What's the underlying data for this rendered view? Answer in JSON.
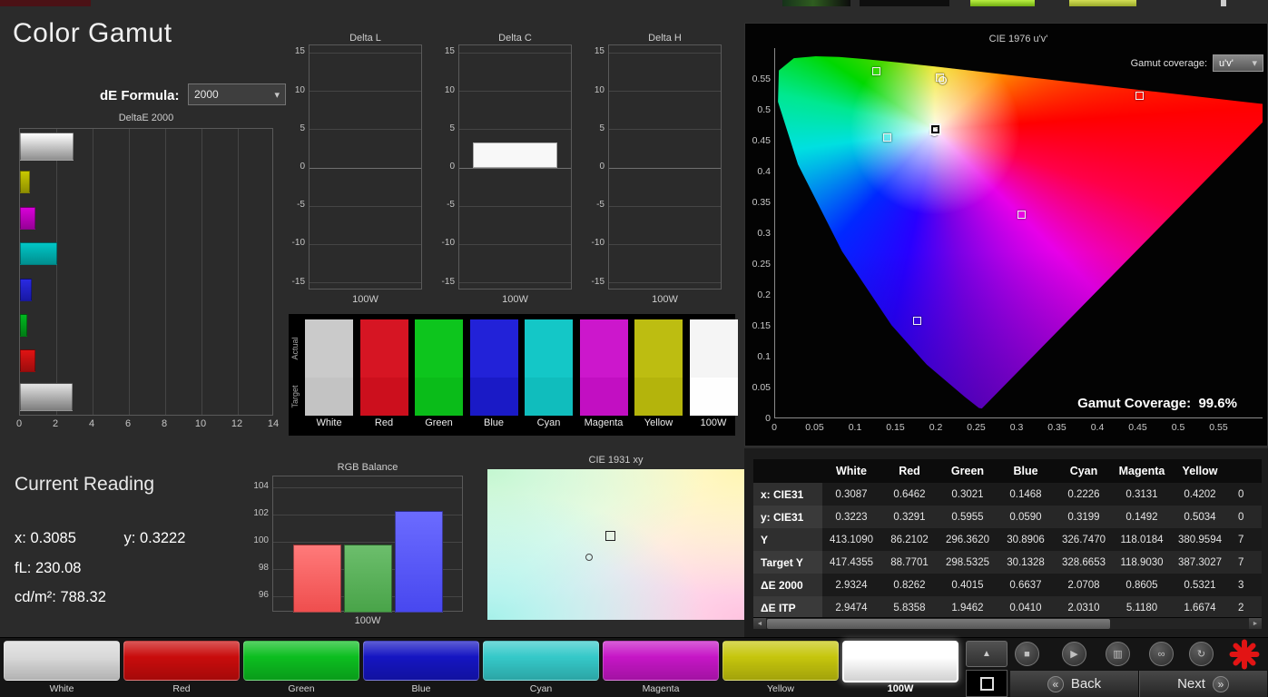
{
  "header": {
    "title": "Color Gamut",
    "de_formula_label": "dE Formula:",
    "de_formula_value": "2000"
  },
  "swatches": {
    "actual_label": "Actual",
    "target_label": "Target",
    "items": [
      {
        "label": "White",
        "actual": "#cacaca",
        "target": "#c3c3c3"
      },
      {
        "label": "Red",
        "actual": "#d61523",
        "target": "#cc0f1d"
      },
      {
        "label": "Green",
        "actual": "#0dc51d",
        "target": "#0abc19"
      },
      {
        "label": "Blue",
        "actual": "#2222d8",
        "target": "#1a1ac6"
      },
      {
        "label": "Cyan",
        "actual": "#14c7c7",
        "target": "#10bdbd"
      },
      {
        "label": "Magenta",
        "actual": "#cc17cc",
        "target": "#c20fc2"
      },
      {
        "label": "Yellow",
        "actual": "#bdbd11",
        "target": "#b4b40c"
      },
      {
        "label": "100W",
        "actual": "#f5f5f5",
        "target": "#fefefe"
      }
    ]
  },
  "cie1976_panel": {
    "title": "CIE 1976 u'v'",
    "coverage_dropdown_label": "Gamut coverage:",
    "coverage_dropdown_value": "u'v'",
    "coverage_caption": "Gamut Coverage:",
    "coverage_value": "99.6%"
  },
  "current_reading": {
    "title": "Current Reading",
    "x_label": "x:",
    "x_value": "0.3085",
    "y_label": "y:",
    "y_value": "0.3222",
    "fl_label": "fL:",
    "fl_value": "230.08",
    "cd_label": "cd/m²:",
    "cd_value": "788.32"
  },
  "cie1931_panel": {
    "title": "CIE 1931 xy"
  },
  "table": {
    "columns": [
      "White",
      "Red",
      "Green",
      "Blue",
      "Cyan",
      "Magenta",
      "Yellow"
    ],
    "rows": [
      {
        "label": "x: CIE31",
        "cells": [
          "0.3087",
          "0.6462",
          "0.3021",
          "0.1468",
          "0.2226",
          "0.3131",
          "0.4202"
        ],
        "clipped": "0"
      },
      {
        "label": "y: CIE31",
        "cells": [
          "0.3223",
          "0.3291",
          "0.5955",
          "0.0590",
          "0.3199",
          "0.1492",
          "0.5034"
        ],
        "clipped": "0"
      },
      {
        "label": "Y",
        "cells": [
          "413.1090",
          "86.2102",
          "296.3620",
          "30.8906",
          "326.7470",
          "118.0184",
          "380.9594"
        ],
        "clipped": "7"
      },
      {
        "label": "Target Y",
        "cells": [
          "417.4355",
          "88.7701",
          "298.5325",
          "30.1328",
          "328.6653",
          "118.9030",
          "387.3027"
        ],
        "clipped": "7"
      },
      {
        "label": "ΔE 2000",
        "cells": [
          "2.9324",
          "0.8262",
          "0.4015",
          "0.6637",
          "2.0708",
          "0.8605",
          "0.5321"
        ],
        "clipped": "3"
      },
      {
        "label": "ΔE ITP",
        "cells": [
          "2.9474",
          "5.8358",
          "1.9462",
          "0.0410",
          "2.0310",
          "5.1180",
          "1.6674"
        ],
        "clipped": "2"
      }
    ]
  },
  "bottom_bar": {
    "patches": [
      {
        "label": "White",
        "color": "#d9d9d9",
        "selected": false
      },
      {
        "label": "Red",
        "color": "#c90c0c",
        "selected": false
      },
      {
        "label": "Green",
        "color": "#0cbe20",
        "selected": false
      },
      {
        "label": "Blue",
        "color": "#1515c2",
        "selected": false
      },
      {
        "label": "Cyan",
        "color": "#35c9c9",
        "selected": false
      },
      {
        "label": "Magenta",
        "color": "#c616c6",
        "selected": false
      },
      {
        "label": "Yellow",
        "color": "#c6c60d",
        "selected": false
      },
      {
        "label": "100W",
        "color": "#ffffff",
        "selected": true
      }
    ],
    "back_label": "Back",
    "next_label": "Next"
  },
  "icons": {
    "dropdown_arrow": "▾",
    "back_chevron": "«",
    "next_chevron": "»",
    "expand_arrow": "▲",
    "stop": "■",
    "play": "▶",
    "save": "▥",
    "link": "∞",
    "refresh": "↻",
    "scroll_left": "◄",
    "scroll_right": "►",
    "asterisk_color": "#e21414"
  },
  "chart_data": [
    {
      "id": "deltae2000",
      "type": "bar",
      "orientation": "horizontal",
      "title": "DeltaE 2000",
      "categories": [
        "White",
        "Yellow",
        "Magenta",
        "Cyan",
        "Blue",
        "Green",
        "Red",
        "100W"
      ],
      "values": [
        2.93,
        0.53,
        0.86,
        2.07,
        0.66,
        0.4,
        0.83,
        2.9
      ],
      "colors": [
        [
          "#ffffff",
          "#8e8e8e"
        ],
        [
          "#c9c900",
          "#8f8f00"
        ],
        [
          "#d800d8",
          "#970097"
        ],
        [
          "#00c6c6",
          "#008f8f"
        ],
        [
          "#2a2ae2",
          "#1818a4"
        ],
        [
          "#00b920",
          "#007d15"
        ],
        [
          "#e01313",
          "#9d0d0d"
        ],
        [
          "#e3e3e3",
          "#7d7d7d"
        ]
      ],
      "xlim": [
        0,
        14
      ],
      "x_ticks": [
        0,
        2,
        4,
        6,
        8,
        10,
        12,
        14
      ]
    },
    {
      "id": "delta_l",
      "type": "bar",
      "title": "Delta L",
      "categories": [
        "100W"
      ],
      "values": [
        0
      ],
      "ylim": [
        -16,
        16
      ],
      "y_ticks": [
        15,
        10,
        5,
        0,
        -5,
        -10,
        -15
      ],
      "xlabel": "100W"
    },
    {
      "id": "delta_c",
      "type": "bar",
      "title": "Delta C",
      "categories": [
        "100W"
      ],
      "values": [
        3.3
      ],
      "ylim": [
        -16,
        16
      ],
      "y_ticks": [
        15,
        10,
        5,
        0,
        -5,
        -10,
        -15
      ],
      "xlabel": "100W"
    },
    {
      "id": "delta_h",
      "type": "bar",
      "title": "Delta H",
      "categories": [
        "100W"
      ],
      "values": [
        0
      ],
      "ylim": [
        -16,
        16
      ],
      "y_ticks": [
        15,
        10,
        5,
        0,
        -5,
        -10,
        -15
      ],
      "xlabel": "100W"
    },
    {
      "id": "rgb_balance",
      "type": "bar",
      "title": "RGB Balance",
      "categories": [
        "Red",
        "Green",
        "Blue"
      ],
      "values": [
        99.8,
        99.8,
        102.3
      ],
      "colors": [
        [
          "#ff7a7a",
          "#ef4e4e"
        ],
        [
          "#6cbe6c",
          "#49a449"
        ],
        [
          "#6b6bff",
          "#4848ef"
        ]
      ],
      "ylim": [
        94.8,
        104.8
      ],
      "y_ticks": [
        104,
        102,
        100,
        98,
        96
      ],
      "xlabel": "100W"
    },
    {
      "id": "cie1976",
      "type": "scatter",
      "title": "CIE 1976 u'v'",
      "x_ticks": [
        "0",
        "0.05",
        "0.1",
        "0.15",
        "0.2",
        "0.25",
        "0.3",
        "0.35",
        "0.4",
        "0.45",
        "0.5",
        "0.55"
      ],
      "y_ticks": [
        "0.55",
        "0.5",
        "0.45",
        "0.4",
        "0.35",
        "0.3",
        "0.25",
        "0.2",
        "0.15",
        "0.1",
        "0.05",
        "0"
      ],
      "gamut_coverage": "99.6%",
      "target_points": [
        {
          "name": "red",
          "u": 0.4507,
          "v": 0.5229
        },
        {
          "name": "green",
          "u": 0.125,
          "v": 0.5625
        },
        {
          "name": "blue",
          "u": 0.1754,
          "v": 0.1579
        },
        {
          "name": "cyan",
          "u": 0.1385,
          "v": 0.4557
        },
        {
          "name": "magenta",
          "u": 0.3046,
          "v": 0.3298
        },
        {
          "name": "yellow",
          "u": 0.2039,
          "v": 0.5529
        }
      ],
      "measured_points": [
        {
          "name": "white",
          "u": 0.1975,
          "v": 0.464
        },
        {
          "name": "yellow",
          "u": 0.207,
          "v": 0.548
        }
      ],
      "white_point": {
        "u": 0.1978,
        "v": 0.4683
      }
    },
    {
      "id": "cie1931",
      "type": "scatter",
      "title": "CIE 1931 xy",
      "measured_points": [
        {
          "name": "white-square",
          "fx": 0.477,
          "fy": 0.44
        },
        {
          "name": "white-circle",
          "fx": 0.4,
          "fy": 0.59
        }
      ]
    }
  ]
}
